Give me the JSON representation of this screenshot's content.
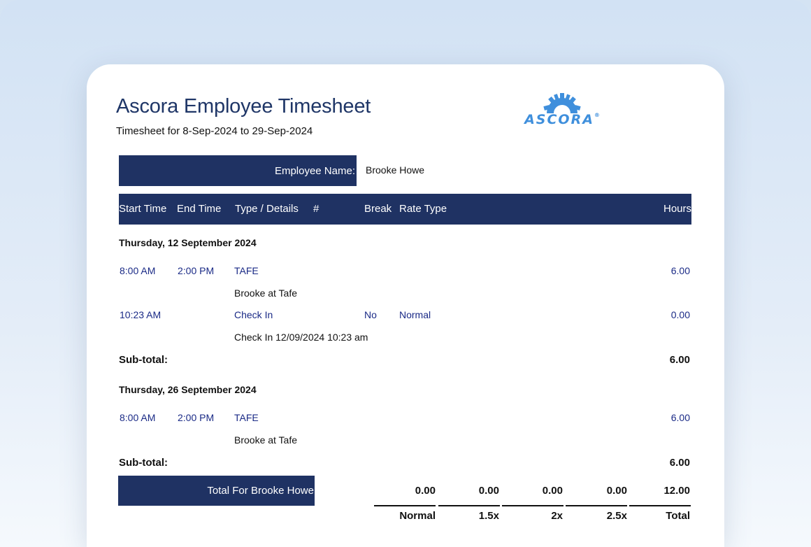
{
  "document": {
    "title": "Ascora Employee Timesheet",
    "subtitle": "Timesheet for 8-Sep-2024 to 29-Sep-2024",
    "logo_text": "ASCORA",
    "logo_mark": "®",
    "employee_label": "Employee Name:",
    "employee_name": "Brooke Howe"
  },
  "columns": {
    "start_time": "Start Time",
    "end_time": "End Time",
    "type_details": "Type / Details",
    "number": "#",
    "break": "Break",
    "rate_type": "Rate Type",
    "hours": "Hours"
  },
  "days": [
    {
      "date": "Thursday, 12 September 2024",
      "entries": [
        {
          "start": "8:00 AM",
          "end": "2:00 PM",
          "type": "TAFE",
          "break": "",
          "rate": "",
          "hours": "6.00",
          "detail": "Brooke at Tafe"
        },
        {
          "start": "10:23 AM",
          "end": "",
          "type": "Check In",
          "break": "No",
          "rate": "Normal",
          "hours": "0.00",
          "detail": "Check In 12/09/2024 10:23 am"
        }
      ],
      "subtotal_label": "Sub-total:",
      "subtotal": "6.00"
    },
    {
      "date": "Thursday, 26 September 2024",
      "entries": [
        {
          "start": "8:00 AM",
          "end": "2:00 PM",
          "type": "TAFE",
          "break": "",
          "rate": "",
          "hours": "6.00",
          "detail": "Brooke at Tafe"
        }
      ],
      "subtotal_label": "Sub-total:",
      "subtotal": "6.00"
    }
  ],
  "totals": {
    "label": "Total For Brooke Howe",
    "values": [
      "0.00",
      "0.00",
      "0.00",
      "0.00",
      "12.00"
    ],
    "headers": [
      "Normal",
      "1.5x",
      "2x",
      "2.5x",
      "Total"
    ]
  },
  "colors": {
    "header_bg": "#1f3263",
    "title": "#1f3667",
    "entry_text": "#1a2a86",
    "logo": "#3f8fdc"
  }
}
